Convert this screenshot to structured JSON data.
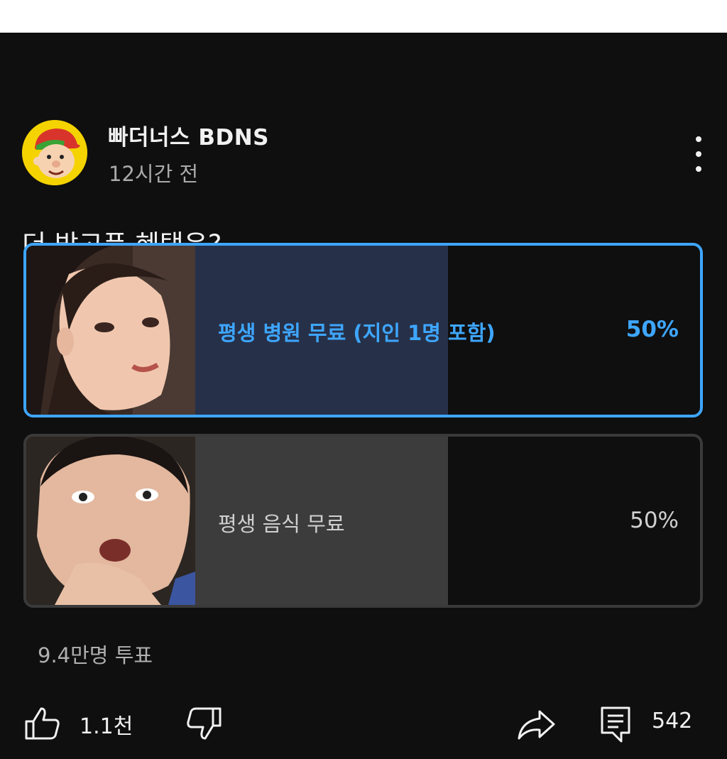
{
  "post": {
    "channel_name": "빠더너스 BDNS",
    "time_ago": "12시간 전",
    "question": "더 받고픈 혜택은?",
    "accent_color": "#3ea6ff"
  },
  "poll": {
    "options": [
      {
        "label": "평생 병원 무료 (지인 1명 포함)",
        "percent_text": "50%",
        "percent": 50,
        "selected": true
      },
      {
        "label": "평생 음식 무료",
        "percent_text": "50%",
        "percent": 50,
        "selected": false
      }
    ],
    "vote_count": "9.4만명 투표"
  },
  "actions": {
    "like_count": "1.1천",
    "comment_count": "542",
    "icons": [
      "thumbs-up-icon",
      "thumbs-down-icon",
      "share-icon",
      "comment-icon"
    ]
  }
}
